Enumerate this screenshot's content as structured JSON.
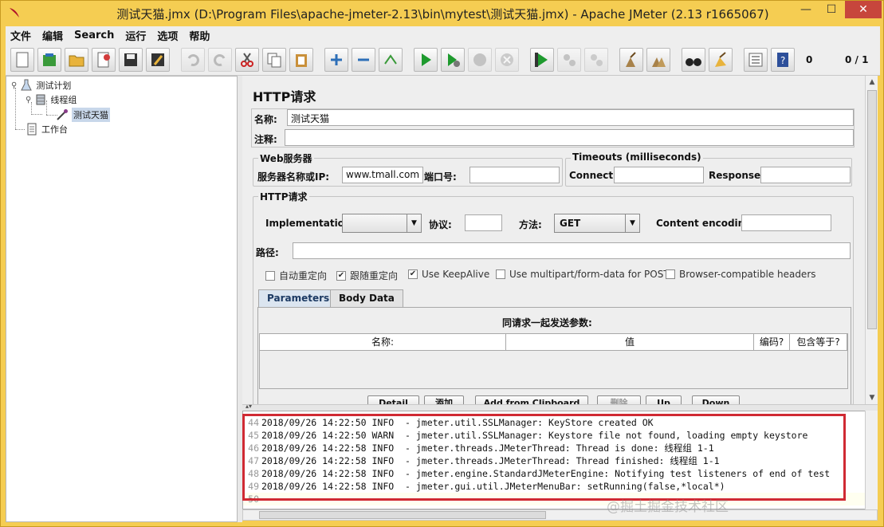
{
  "window": {
    "title": "测试天猫.jmx (D:\\Program Files\\apache-jmeter-2.13\\bin\\mytest\\测试天猫.jmx) - Apache JMeter (2.13 r1665067)",
    "minimize": "—",
    "maximize": "☐",
    "close": "✕"
  },
  "menu": [
    "文件",
    "编辑",
    "Search",
    "运行",
    "选项",
    "帮助"
  ],
  "toolbar": {
    "error_count": "0",
    "thread_count": "0 / 1"
  },
  "tree": {
    "items": [
      {
        "label": "测试计划"
      },
      {
        "label": "线程组"
      },
      {
        "label": "测试天猫"
      },
      {
        "label": "工作台"
      }
    ]
  },
  "form": {
    "title": "HTTP请求",
    "name_label": "名称:",
    "name_value": "测试天猫",
    "comment_label": "注释:",
    "comment_value": "",
    "web_server_group": "Web服务器",
    "server_label": "服务器名称或IP:",
    "server_value": "www.tmall.com",
    "port_label": "端口号:",
    "port_value": "",
    "timeouts_group": "Timeouts (milliseconds)",
    "connect_label": "Connect:",
    "response_label": "Response:",
    "http_group": "HTTP请求",
    "impl_label": "Implementation:",
    "impl_value": "",
    "protocol_label": "协议:",
    "protocol_value": "",
    "method_label": "方法:",
    "method_value": "GET",
    "encoding_label": "Content encoding:",
    "path_label": "路径:",
    "path_value": "",
    "checkboxes": [
      {
        "label": "自动重定向",
        "checked": false
      },
      {
        "label": "跟随重定向",
        "checked": true
      },
      {
        "label": "Use KeepAlive",
        "checked": true
      },
      {
        "label": "Use multipart/form-data for POST",
        "checked": false
      },
      {
        "label": "Browser-compatible headers",
        "checked": false
      }
    ],
    "tabs": [
      "Parameters",
      "Body Data"
    ],
    "params_caption": "同请求一起发送参数:",
    "columns": [
      "名称:",
      "值",
      "编码?",
      "包含等于?"
    ],
    "buttons": [
      "Detail",
      "添加",
      "Add from Clipboard",
      "删除",
      "Up",
      "Down"
    ]
  },
  "log": {
    "lines": [
      {
        "n": "44",
        "text": "2018/09/26 14:22:50 INFO  - jmeter.util.SSLManager: KeyStore created OK"
      },
      {
        "n": "45",
        "text": "2018/09/26 14:22:50 WARN  - jmeter.util.SSLManager: Keystore file not found, loading empty keystore"
      },
      {
        "n": "46",
        "text": "2018/09/26 14:22:58 INFO  - jmeter.threads.JMeterThread: Thread is done: 线程组 1-1"
      },
      {
        "n": "47",
        "text": "2018/09/26 14:22:58 INFO  - jmeter.threads.JMeterThread: Thread finished: 线程组 1-1"
      },
      {
        "n": "48",
        "text": "2018/09/26 14:22:58 INFO  - jmeter.engine.StandardJMeterEngine: Notifying test listeners of end of test"
      },
      {
        "n": "49",
        "text": "2018/09/26 14:22:58 INFO  - jmeter.gui.util.JMeterMenuBar: setRunning(false,*local*)"
      },
      {
        "n": "50",
        "text": ""
      }
    ]
  },
  "watermark": "@掘土掘金技术社区"
}
